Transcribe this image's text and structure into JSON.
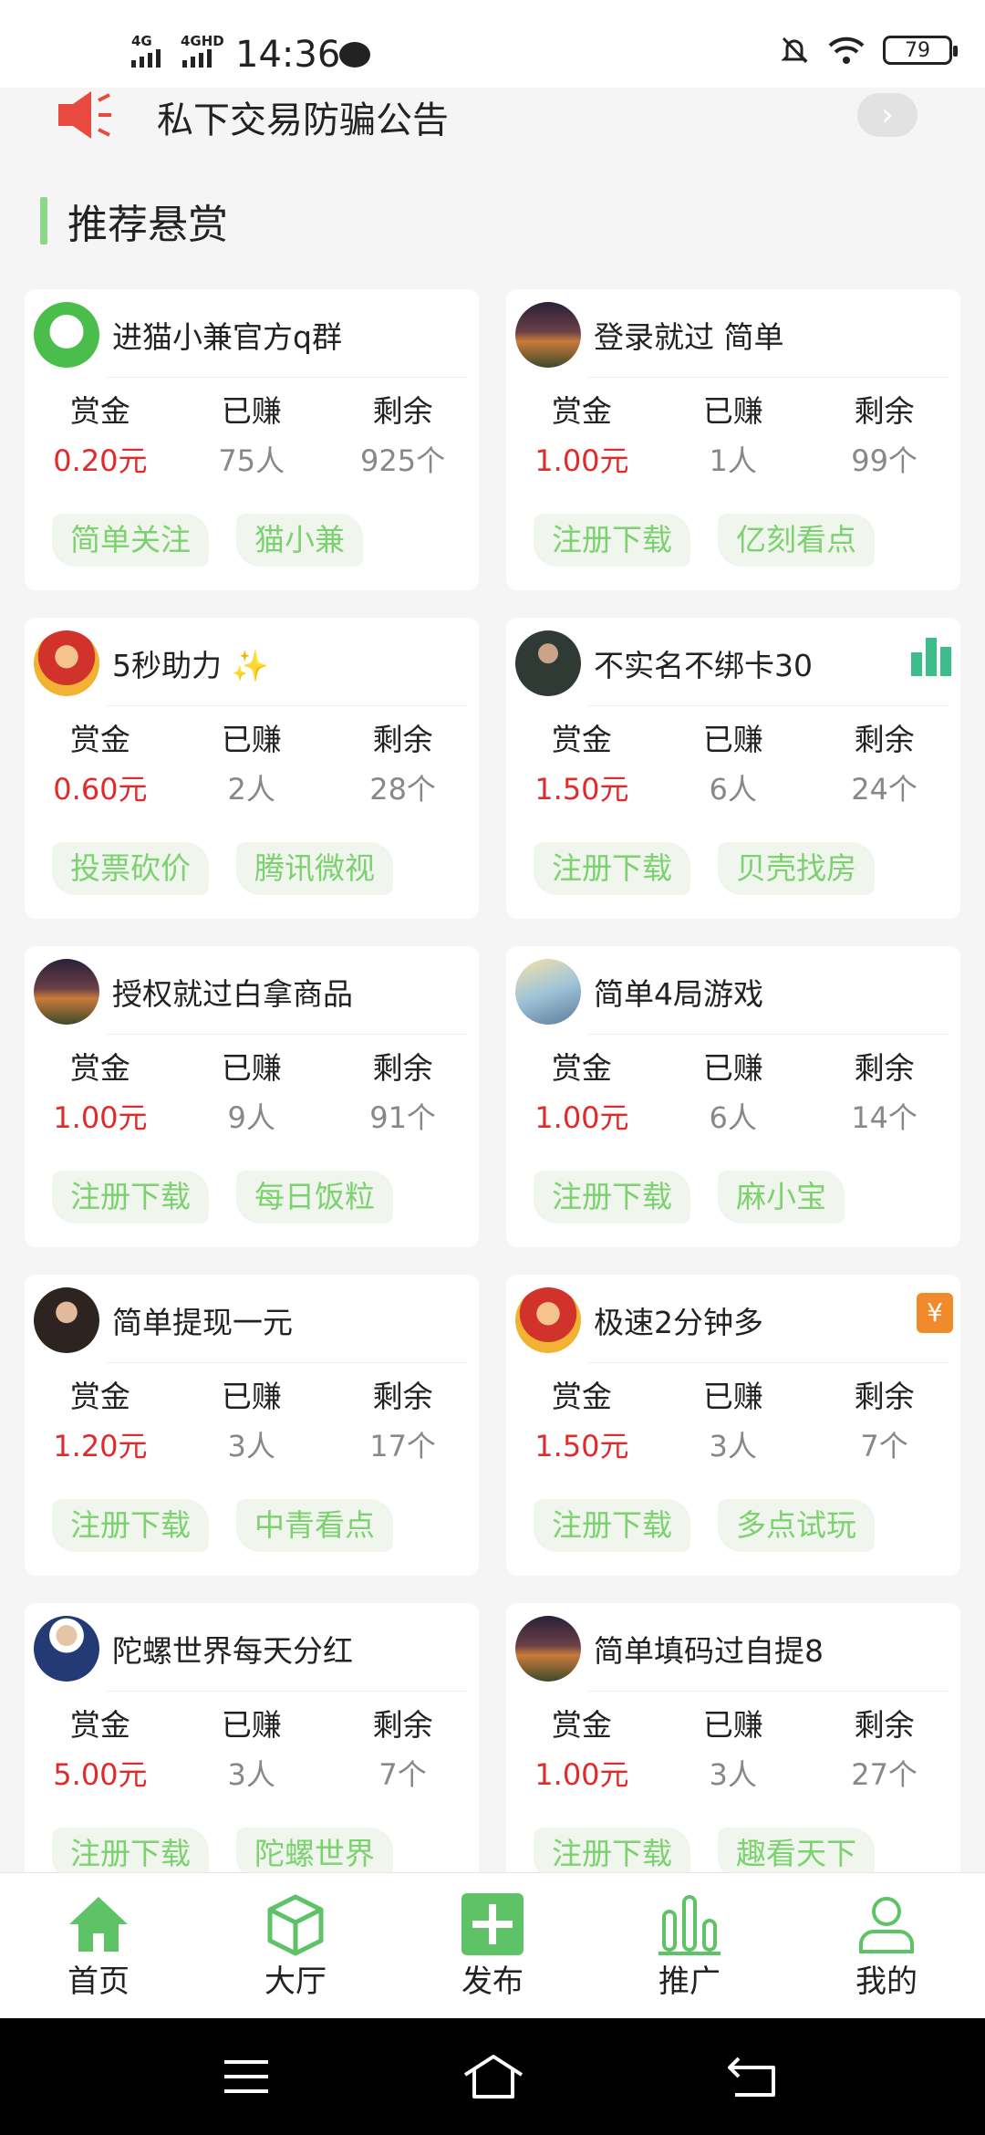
{
  "status_bar": {
    "network_1": "4G",
    "network_2": "4GHD",
    "time": "14:36",
    "battery": "79"
  },
  "notice": {
    "text": "私下交易防骗公告",
    "arrow": "›"
  },
  "section_title": "推荐悬赏",
  "labels": {
    "reward": "赏金",
    "earned": "已赚",
    "remaining": "剩余"
  },
  "colors": {
    "accent_green": "#7cd26e",
    "reward_red": "#e12b2b",
    "nav_active": "#4caf50"
  },
  "cards": [
    {
      "title": "进猫小兼官方q群",
      "reward": "0.20元",
      "earned": "75人",
      "remaining": "925个",
      "tags": [
        "简单关注",
        "猫小兼"
      ],
      "avatar": "green-logo-avatar"
    },
    {
      "title": "登录就过 简单",
      "reward": "1.00元",
      "earned": "1人",
      "remaining": "99个",
      "tags": [
        "注册下载",
        "亿刻看点"
      ],
      "avatar": "landscape-avatar"
    },
    {
      "title": "5秒助力 ✨",
      "reward": "0.60元",
      "earned": "2人",
      "remaining": "28个",
      "tags": [
        "投票砍价",
        "腾讯微视"
      ],
      "avatar": "god-of-wealth-avatar"
    },
    {
      "title": "不实名不绑卡30",
      "reward": "1.50元",
      "earned": "6人",
      "remaining": "24个",
      "tags": [
        "注册下载",
        "贝壳找房"
      ],
      "avatar": "person-avatar",
      "badge": "bar-chart-icon"
    },
    {
      "title": "授权就过白拿商品",
      "reward": "1.00元",
      "earned": "9人",
      "remaining": "91个",
      "tags": [
        "注册下载",
        "每日饭粒"
      ],
      "avatar": "landscape-avatar"
    },
    {
      "title": "简单4局游戏",
      "reward": "1.00元",
      "earned": "6人",
      "remaining": "14个",
      "tags": [
        "注册下载",
        "麻小宝"
      ],
      "avatar": "anime-avatar"
    },
    {
      "title": "简单提现一元",
      "reward": "1.20元",
      "earned": "3人",
      "remaining": "17个",
      "tags": [
        "注册下载",
        "中青看点"
      ],
      "avatar": "woman-avatar"
    },
    {
      "title": "极速2分钟多",
      "reward": "1.50元",
      "earned": "3人",
      "remaining": "7个",
      "tags": [
        "注册下载",
        "多点试玩"
      ],
      "avatar": "god-of-wealth-avatar",
      "badge": "yuan-icon",
      "badge_text": "¥"
    },
    {
      "title": "陀螺世界每天分红",
      "reward": "5.00元",
      "earned": "3人",
      "remaining": "7个",
      "tags": [
        "注册下载",
        "陀螺世界"
      ],
      "avatar": "man-suit-avatar"
    },
    {
      "title": "简单填码过自提8",
      "reward": "1.00元",
      "earned": "3人",
      "remaining": "27个",
      "tags": [
        "注册下载",
        "趣看天下"
      ],
      "avatar": "landscape-avatar"
    }
  ],
  "bottom_nav": {
    "items": [
      {
        "label": "首页",
        "icon": "home-icon",
        "active": true
      },
      {
        "label": "大厅",
        "icon": "cube-icon"
      },
      {
        "label": "发布",
        "icon": "plus-icon"
      },
      {
        "label": "推广",
        "icon": "bar-chart-icon"
      },
      {
        "label": "我的",
        "icon": "user-icon"
      }
    ]
  }
}
